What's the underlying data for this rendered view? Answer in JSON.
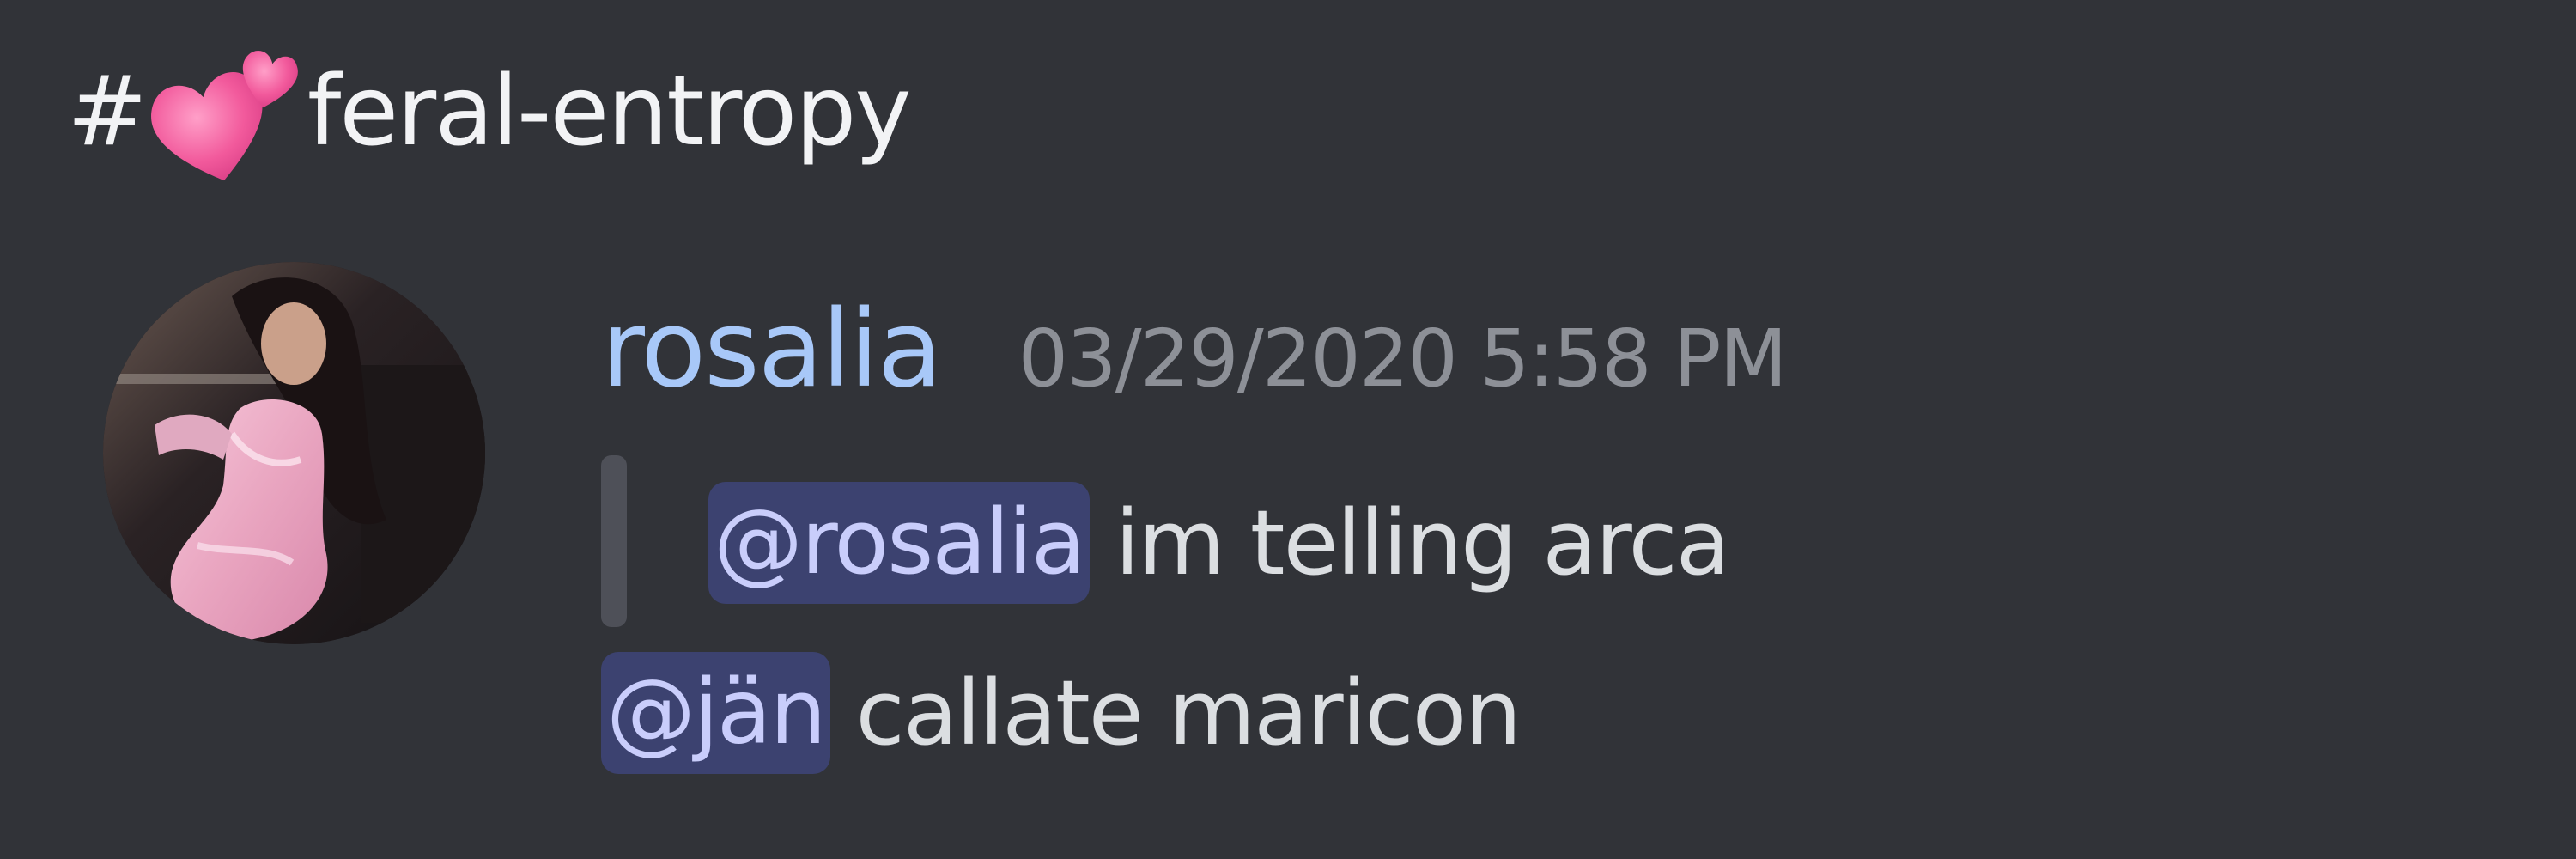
{
  "channel": {
    "hash": "#",
    "icon": "two-hearts-icon",
    "name": "feral-entropy"
  },
  "message": {
    "avatar_icon": "user-avatar",
    "username": "rosalia",
    "timestamp": "03/29/2020 5:58 PM",
    "reply": {
      "mention": "@rosalia",
      "text": "im telling arca"
    },
    "body": {
      "mention": "@jän",
      "text": "callate maricon"
    }
  },
  "colors": {
    "background": "#313338",
    "username": "#a8c8f8",
    "timestamp": "#8d9097",
    "mention_bg": "#3c4270",
    "mention_text": "#c9cdfb",
    "text": "#dbdee1",
    "quote_bar": "#4e5058",
    "hearts": "#f0629f"
  }
}
